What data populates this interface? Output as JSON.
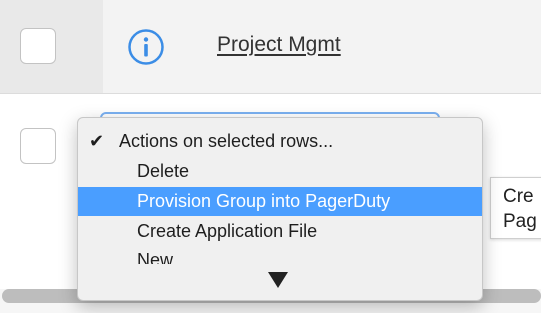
{
  "rows": [
    {
      "link_text": "Project Mgmt",
      "icon": "info-circle-icon"
    }
  ],
  "dropdown": {
    "selected_label": "Actions on selected rows...",
    "items": [
      {
        "label": "Actions on selected rows...",
        "selected": true
      },
      {
        "label": "Delete"
      },
      {
        "label": "Provision Group into PagerDuty",
        "highlighted": true
      },
      {
        "label": "Create Application File"
      },
      {
        "label": "New"
      }
    ],
    "more_indicator": "scroll-down-arrow-icon"
  },
  "tooltip": {
    "text": "Cre\nPag"
  },
  "colors": {
    "highlight": "#4a9eff",
    "info_icon": "#3b8de6",
    "select_focus": "#7bb1f2"
  }
}
